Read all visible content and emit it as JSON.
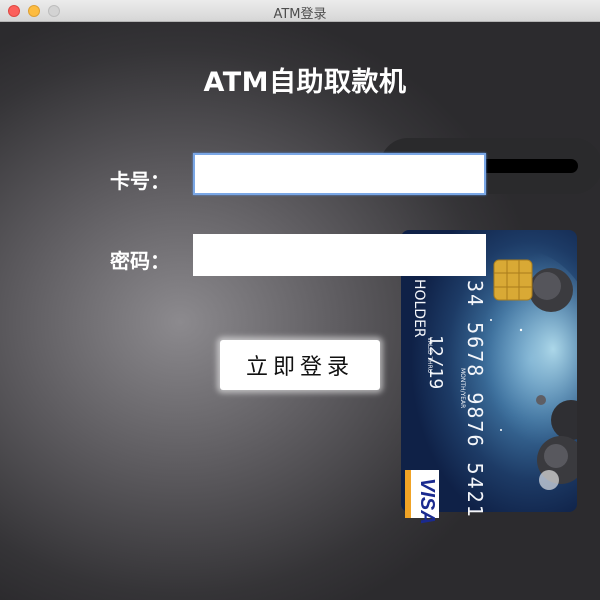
{
  "window": {
    "title": "ATM登录"
  },
  "app": {
    "title": "ATM自助取款机"
  },
  "form": {
    "card_label": "卡号：",
    "card_value": "",
    "password_label": "密码：",
    "password_value": "",
    "login_label": "立即登录"
  },
  "card": {
    "number": "34 5678 9876 5421",
    "holder": "RD HOLDER",
    "valid_label": "VALID THRU",
    "mmyy_label": "MONTH/YEAR",
    "expiry": "12/19",
    "brand": "VISA"
  },
  "colors": {
    "focus_ring": "#7aa7e6",
    "visa_blue": "#1a2a8f",
    "visa_gold": "#f0a326"
  }
}
